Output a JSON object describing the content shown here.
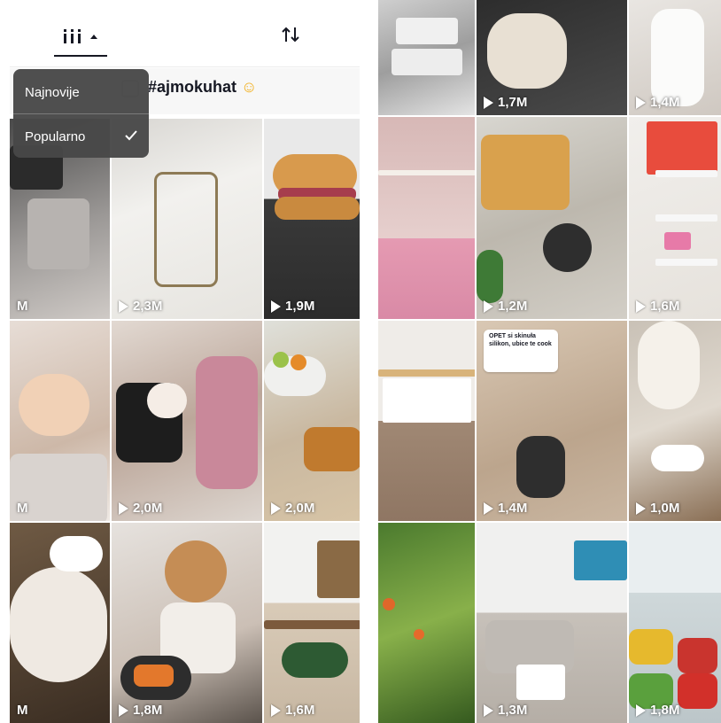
{
  "left_screen": {
    "sort_icon": "grid-columns-icon",
    "swap_icon": "swap-arrows-icon",
    "hashtag": "#ajmokuhat",
    "hashtag_emoji": "☺",
    "sort_menu": {
      "items": [
        {
          "label": "Najnovije",
          "selected": false
        },
        {
          "label": "Popularno",
          "selected": true
        }
      ]
    },
    "videos": [
      {
        "views": "M",
        "scene": "car-seat"
      },
      {
        "views": "2,3M",
        "scene": "phone-case"
      },
      {
        "views": "1,9M",
        "scene": "burger"
      },
      {
        "views": "M",
        "scene": "mother-child"
      },
      {
        "views": "2,0M",
        "scene": "family-baby"
      },
      {
        "views": "2,0M",
        "scene": "fruit-bowl-sandwich"
      },
      {
        "views": "M",
        "scene": "pasta-salad"
      },
      {
        "views": "1,8M",
        "scene": "toddler-eating"
      },
      {
        "views": "1,6M",
        "scene": "kitchen-salad"
      }
    ]
  },
  "right_screen": {
    "videos": [
      {
        "views": "",
        "scene": "shelf-boxes"
      },
      {
        "views": "1,7M",
        "scene": "creamy-pasta"
      },
      {
        "views": "1,4M",
        "scene": "white-dress"
      },
      {
        "views": "",
        "scene": "pink-room"
      },
      {
        "views": "1,2M",
        "scene": "baked-dish"
      },
      {
        "views": "1,6M",
        "scene": "kids-bookshelf"
      },
      {
        "views": "",
        "scene": "kitchen-interior"
      },
      {
        "views": "1,4M",
        "scene": "shower-wall",
        "comment": {
          "text": "OPET si skinuła silikon, ubice te cook"
        }
      },
      {
        "views": "1,0M",
        "scene": "bathroom-sink"
      },
      {
        "views": "",
        "scene": "tomato-plant"
      },
      {
        "views": "1,3M",
        "scene": "living-room-sofa"
      },
      {
        "views": "1,8M",
        "scene": "fridge-vegetables"
      }
    ]
  },
  "colors": {
    "text_dark": "#161823",
    "menu_bg": "#484848",
    "overlay_text": "#ffffff"
  }
}
